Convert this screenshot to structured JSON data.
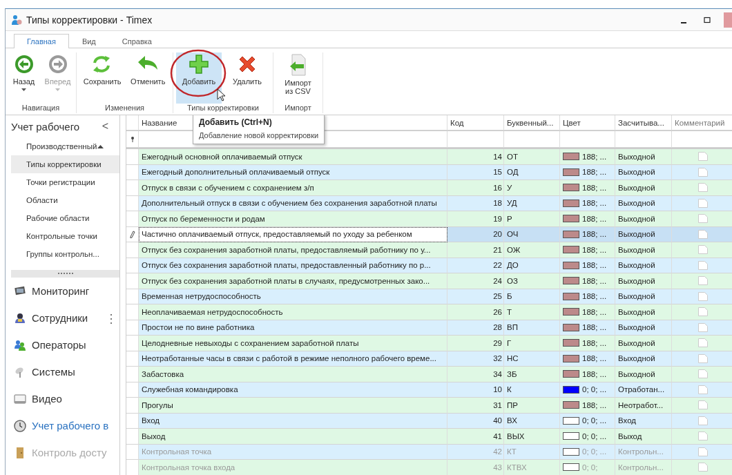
{
  "window": {
    "title": "Типы корректировки - Timex"
  },
  "ribbon": {
    "tabs": [
      {
        "label": "Главная",
        "selected": true
      },
      {
        "label": "Вид",
        "selected": false
      },
      {
        "label": "Справка",
        "selected": false
      }
    ],
    "groups": [
      {
        "label": "Навигация",
        "buttons": [
          {
            "label": "Назад",
            "kind": "back",
            "disabled": false,
            "dropdown": true,
            "hovered": false
          },
          {
            "label": "Вперед",
            "kind": "forward",
            "disabled": true,
            "dropdown": true,
            "hovered": false
          }
        ]
      },
      {
        "label": "Изменения",
        "buttons": [
          {
            "label": "Сохранить",
            "kind": "refresh",
            "disabled": false,
            "dropdown": false,
            "hovered": false
          },
          {
            "label": "Отменить",
            "kind": "undo",
            "disabled": false,
            "dropdown": false,
            "hovered": false
          }
        ]
      },
      {
        "label": "Типы корректировки",
        "buttons": [
          {
            "label": "Добавить",
            "kind": "add",
            "disabled": false,
            "dropdown": false,
            "hovered": true
          },
          {
            "label": "Удалить",
            "kind": "delete",
            "disabled": false,
            "dropdown": false,
            "hovered": false
          }
        ]
      },
      {
        "label": "Импорт",
        "buttons": [
          {
            "label": "Импорт из CSV",
            "kind": "import",
            "disabled": false,
            "dropdown": false,
            "hovered": false
          }
        ]
      }
    ]
  },
  "tooltip": {
    "title": "Добавить (Ctrl+N)",
    "text": "Добавление новой корректировки"
  },
  "sidebar": {
    "header": "Учет рабочего",
    "collapse": "<",
    "items": [
      {
        "label": "Производственный",
        "selected": false
      },
      {
        "label": "Типы корректировки",
        "selected": true
      },
      {
        "label": "Точки регистрации",
        "selected": false
      },
      {
        "label": "Области",
        "selected": false
      },
      {
        "label": "Рабочие области",
        "selected": false
      },
      {
        "label": "Контрольные точки",
        "selected": false
      },
      {
        "label": "Группы контрольн...",
        "selected": false
      }
    ],
    "modules": [
      {
        "label": "Мониторинг",
        "kind": "monitor",
        "selected": false,
        "dimmed": false
      },
      {
        "label": "Сотрудники",
        "kind": "employees",
        "selected": false,
        "dimmed": false
      },
      {
        "label": "Операторы",
        "kind": "operators",
        "selected": false,
        "dimmed": false
      },
      {
        "label": "Системы",
        "kind": "systems",
        "selected": false,
        "dimmed": false
      },
      {
        "label": "Видео",
        "kind": "video",
        "selected": false,
        "dimmed": false
      },
      {
        "label": "Учет рабочего в",
        "kind": "clock",
        "selected": true,
        "dimmed": false
      },
      {
        "label": "Контроль досту",
        "kind": "door",
        "selected": false,
        "dimmed": true
      }
    ]
  },
  "table": {
    "columns": [
      "Название",
      "Код",
      "Буквенный...",
      "Цвет",
      "Засчитыва...",
      "Комментарий"
    ],
    "rows": [
      {
        "name": "Ежегодный основной оплачиваемый отпуск",
        "code": "14",
        "letter": "ОТ",
        "color": "#bc8a8a",
        "color_text": "188; ...",
        "counted": "Выходной",
        "selected": false,
        "dimmed": false
      },
      {
        "name": "Ежегодный дополнительный оплачиваемый отпуск",
        "code": "15",
        "letter": "ОД",
        "color": "#bc8a8a",
        "color_text": "188; ...",
        "counted": "Выходной",
        "selected": false,
        "dimmed": false
      },
      {
        "name": "Отпуск в связи с обучением с сохранением з/п",
        "code": "16",
        "letter": "У",
        "color": "#bc8a8a",
        "color_text": "188; ...",
        "counted": "Выходной",
        "selected": false,
        "dimmed": false
      },
      {
        "name": "Дополнительный отпуск в связи с обучением без сохранения заработной платы",
        "code": "18",
        "letter": "УД",
        "color": "#bc8a8a",
        "color_text": "188; ...",
        "counted": "Выходной",
        "selected": false,
        "dimmed": false
      },
      {
        "name": "Отпуск по беременности и родам",
        "code": "19",
        "letter": "Р",
        "color": "#bc8a8a",
        "color_text": "188; ...",
        "counted": "Выходной",
        "selected": false,
        "dimmed": false
      },
      {
        "name": "Частично оплачиваемый отпуск, предоставляемый по уходу за ребенком",
        "code": "20",
        "letter": "ОЧ",
        "color": "#bc8a8a",
        "color_text": "188; ...",
        "counted": "Выходной",
        "selected": true,
        "dimmed": false
      },
      {
        "name": "Отпуск без сохранения заработной платы, предоставляемый работнику по у...",
        "code": "21",
        "letter": "ОЖ",
        "color": "#bc8a8a",
        "color_text": "188; ...",
        "counted": "Выходной",
        "selected": false,
        "dimmed": false
      },
      {
        "name": "Отпуск без сохранения заработной платы, предоставленный работнику по р...",
        "code": "22",
        "letter": "ДО",
        "color": "#bc8a8a",
        "color_text": "188; ...",
        "counted": "Выходной",
        "selected": false,
        "dimmed": false
      },
      {
        "name": "Отпуск без сохранения заработной платы в случаях, предусмотренных зако...",
        "code": "24",
        "letter": "ОЗ",
        "color": "#bc8a8a",
        "color_text": "188; ...",
        "counted": "Выходной",
        "selected": false,
        "dimmed": false
      },
      {
        "name": "Временная нетрудоспособность",
        "code": "25",
        "letter": "Б",
        "color": "#bc8a8a",
        "color_text": "188; ...",
        "counted": "Выходной",
        "selected": false,
        "dimmed": false
      },
      {
        "name": "Неоплачиваемая нетрудоспособность",
        "code": "26",
        "letter": "Т",
        "color": "#bc8a8a",
        "color_text": "188; ...",
        "counted": "Выходной",
        "selected": false,
        "dimmed": false
      },
      {
        "name": "Простои не по вине работника",
        "code": "28",
        "letter": "ВП",
        "color": "#bc8a8a",
        "color_text": "188; ...",
        "counted": "Выходной",
        "selected": false,
        "dimmed": false
      },
      {
        "name": "Целодневные невыходы с сохранением заработной платы",
        "code": "29",
        "letter": "Г",
        "color": "#bc8a8a",
        "color_text": "188; ...",
        "counted": "Выходной",
        "selected": false,
        "dimmed": false
      },
      {
        "name": "Неотработанные часы в связи с работой в режиме неполного рабочего време...",
        "code": "32",
        "letter": "НС",
        "color": "#bc8a8a",
        "color_text": "188; ...",
        "counted": "Выходной",
        "selected": false,
        "dimmed": false
      },
      {
        "name": "Забастовка",
        "code": "34",
        "letter": "ЗБ",
        "color": "#bc8a8a",
        "color_text": "188; ...",
        "counted": "Выходной",
        "selected": false,
        "dimmed": false
      },
      {
        "name": "Служебная командировка",
        "code": "10",
        "letter": "К",
        "color": "#0000ff",
        "color_text": "0; 0; ...",
        "counted": "Отработан...",
        "selected": false,
        "dimmed": false
      },
      {
        "name": "Прогулы",
        "code": "31",
        "letter": "ПР",
        "color": "#bc8a8a",
        "color_text": "188; ...",
        "counted": "Неотработ...",
        "selected": false,
        "dimmed": false
      },
      {
        "name": "Вход",
        "code": "40",
        "letter": "ВХ",
        "color": "#ffffff",
        "color_text": "0; 0; ...",
        "counted": "Вход",
        "selected": false,
        "dimmed": false
      },
      {
        "name": "Выход",
        "code": "41",
        "letter": "ВЫХ",
        "color": "#ffffff",
        "color_text": "0; 0; ...",
        "counted": "Выход",
        "selected": false,
        "dimmed": false
      },
      {
        "name": "Контрольная точка",
        "code": "42",
        "letter": "КТ",
        "color": "#ffffff",
        "color_text": "0; 0; ...",
        "counted": "Контрольн...",
        "selected": false,
        "dimmed": true
      },
      {
        "name": "Контрольная точка входа",
        "code": "43",
        "letter": "КТВХ",
        "color": "#ffffff",
        "color_text": "0; 0;",
        "counted": "Контрольн...",
        "selected": false,
        "dimmed": true
      }
    ]
  }
}
